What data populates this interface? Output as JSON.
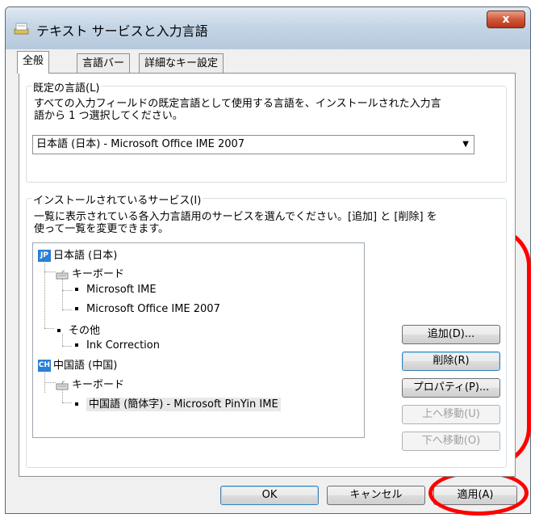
{
  "window": {
    "title": "テキスト サービスと入力言語",
    "close_label": "x"
  },
  "tabs": [
    {
      "label": "全般",
      "active": true
    },
    {
      "label": "言語バー",
      "active": false
    },
    {
      "label": "詳細なキー設定",
      "active": false
    }
  ],
  "default_language": {
    "group_title": "既定の言語(L)",
    "description_line1": "すべての入力フィールドの既定言語として使用する言語を、インストールされた入力言",
    "description_line2": "語から 1 つ選択してください。",
    "selected_value": "日本語 (日本) - Microsoft Office IME 2007"
  },
  "installed_services": {
    "group_title": "インストールされているサービス(I)",
    "description_line1": "一覧に表示されている各入力言語用のサービスを選んでください。[追加] と [削除] を",
    "description_line2": "使って一覧を変更できます。",
    "tree": {
      "lang1": {
        "badge": "JP",
        "label": "日本語 (日本)"
      },
      "lang1_keyboard": "キーボード",
      "lang1_kb_item1": "Microsoft IME",
      "lang1_kb_item2": "Microsoft Office IME 2007",
      "lang1_other": "その他",
      "lang1_other_item1": "Ink Correction",
      "lang2": {
        "badge": "CH",
        "label": "中国語 (中国)"
      },
      "lang2_keyboard": "キーボード",
      "lang2_kb_item1": "中国語 (簡体字) - Microsoft PinYin IME"
    },
    "buttons": {
      "add": "追加(D)...",
      "remove": "削除(R)",
      "properties": "プロパティ(P)...",
      "move_up": "上へ移動(U)",
      "move_down": "下へ移動(O)"
    }
  },
  "footer": {
    "ok": "OK",
    "cancel": "キャンセル",
    "apply": "適用(A)"
  },
  "colors": {
    "annotation": "#ff0000",
    "accent": "#2a7fd6"
  }
}
